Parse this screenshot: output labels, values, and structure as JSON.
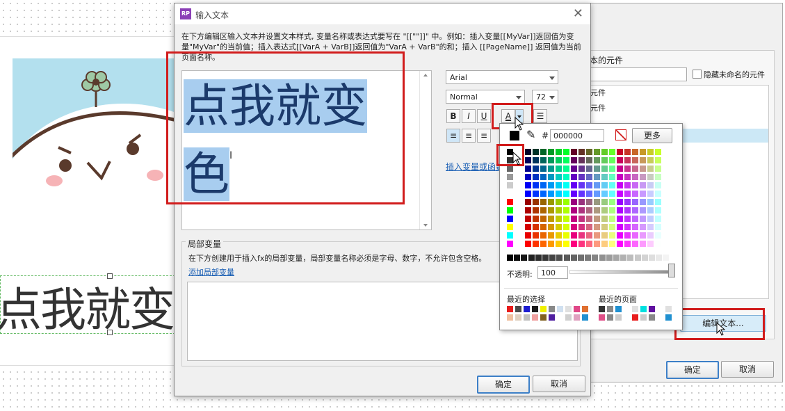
{
  "dialog": {
    "title": "输入文本",
    "description": "在下方编辑区输入文本并设置文本样式, 变量名称或表达式要写在 \"[[\"\"]]\" 中。例如：插入变量[[MyVar]]返回值为变量\"MyVar\"的当前值；插入表达式[[VarA + VarB]]返回值为\"VarA + VarB\"的和；插入 [[PageName]] 返回值为当前页面名称。",
    "editor_line1": "点我就变",
    "editor_line2": "色",
    "font_family": "Arial",
    "font_style": "Normal",
    "font_size": "72",
    "bold": "B",
    "italic": "I",
    "underline": "U",
    "font_color_btn": "A",
    "insert_link": "插入变量或函数...",
    "local_vars_title": "局部变量",
    "local_vars_desc": "在下方创建用于插入fx的局部变量，局部变量名称必须是字母、数字，不允许包含空格。",
    "add_local_var": "添加局部变量",
    "ok": "确定",
    "cancel": "取消"
  },
  "picker": {
    "hash": "#",
    "hex_value": "000000",
    "more": "更多",
    "opacity_label": "不透明:",
    "opacity_value": "100",
    "recent_choices": "最近的选择",
    "recent_pages": "最近的页面"
  },
  "back_panel": {
    "header_partial": "本的元件",
    "hide_unnamed": "隐藏未命名的元件",
    "item1": "元件",
    "item2": "元件",
    "edit_text_btn": "编辑文本...",
    "ok": "确定",
    "cancel": "取消"
  },
  "canvas": {
    "big_text": "点我就变"
  },
  "colors": {
    "accent_red": "#d11c1c",
    "selection": "#a8cdef",
    "text_blue": "#1b3a6b"
  }
}
